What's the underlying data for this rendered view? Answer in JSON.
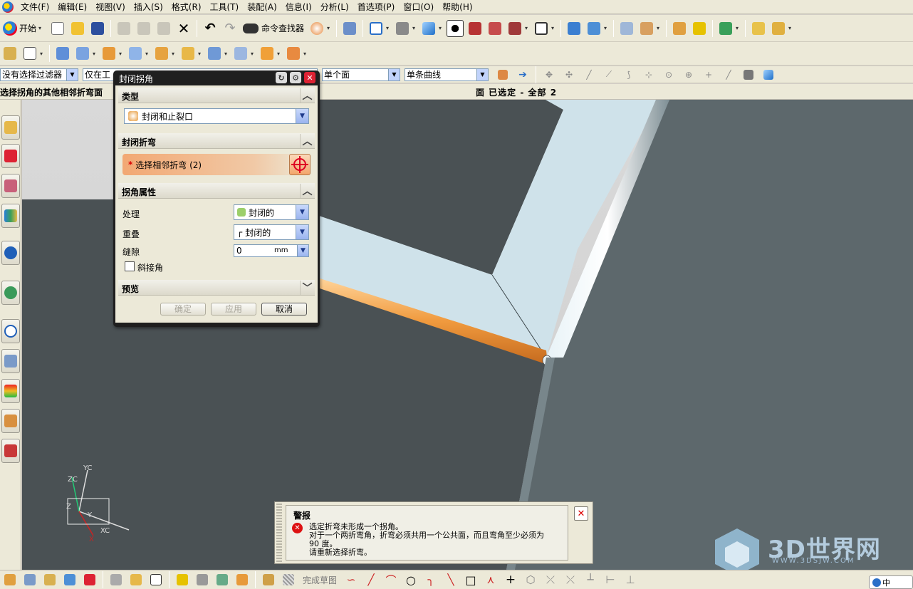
{
  "menubar": {
    "items": [
      "文件(F)",
      "编辑(E)",
      "视图(V)",
      "插入(S)",
      "格式(R)",
      "工具(T)",
      "装配(A)",
      "信息(I)",
      "分析(L)",
      "首选项(P)",
      "窗口(O)",
      "帮助(H)"
    ]
  },
  "toolbar": {
    "start_label": "开始",
    "command_finder_label": "命令查找器"
  },
  "filters": {
    "type_filter": "没有选择过滤器",
    "scope_filter": "仅在工",
    "face_rule": "单个面",
    "curve_rule": "单条曲线"
  },
  "status": {
    "prompt": "选择拐角的其他相邻折弯面",
    "selection": "面 已选定 - 全部 2"
  },
  "dialog": {
    "title": "封闭拐角",
    "type_section": "类型",
    "type_value": "封闭和止裂口",
    "bends_section": "封闭折弯",
    "select_bends_label": "选择相邻折弯 (2)",
    "select_star": "*",
    "corner_section": "拐角属性",
    "treatment_label": "处理",
    "treatment_value": "封闭的",
    "overlap_label": "重叠",
    "overlap_value": "封闭的",
    "gap_label": "缝隙",
    "gap_value": "0",
    "gap_unit": "mm",
    "miter_label": "斜接角",
    "preview_section": "预览",
    "ok_label": "确定",
    "apply_label": "应用",
    "cancel_label": "取消"
  },
  "alert": {
    "title": "警报",
    "message_1": "选定折弯未形成一个拐角。",
    "message_2": "对于一个两折弯角，折弯必须共用一个公共面，而且弯角至少必须为",
    "message_3": "90 度。",
    "message_4": "请重新选择折弯。"
  },
  "bottombar": {
    "finish_sketch": "完成草图"
  },
  "triad": {
    "zc": "ZC",
    "yc": "YC",
    "xc": "XC",
    "z": "Z",
    "y": "Y",
    "x": "X"
  },
  "watermark": {
    "text": "3D世界网",
    "url": "WWW.3DSJW.COM"
  },
  "ime": {
    "label": "中"
  },
  "colors": {
    "highlight_orange": "#f09a3e",
    "dark_face": "#4a5154",
    "light_face": "#cfe2ea",
    "side_face": "#5d686c"
  }
}
